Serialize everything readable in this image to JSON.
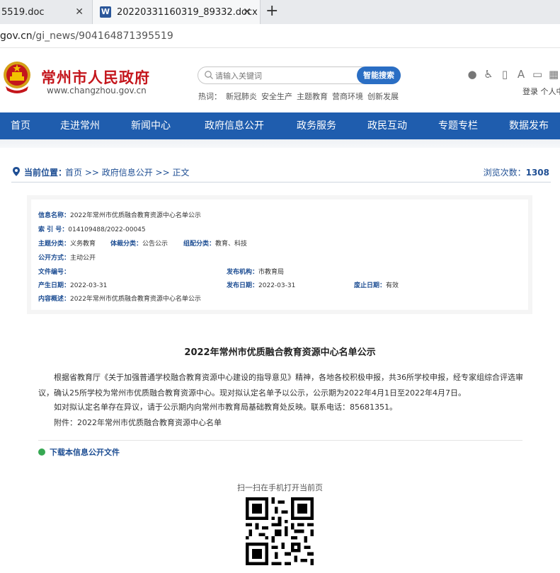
{
  "browser": {
    "tabs": [
      {
        "title": "5519.doc"
      },
      {
        "title": "20220331160319_89332.docx",
        "icon": "word-icon"
      }
    ],
    "new_tab": "+",
    "close": "✕",
    "url_host": "gov.cn",
    "url_path": "/gi_news/904164871395519"
  },
  "header": {
    "site_name": "常州市人民政府",
    "domain": "www.changzhou.gov.cn",
    "search_placeholder": "请输入关键词",
    "search_button": "智能搜索",
    "hot_label": "热词：",
    "hot_words": [
      "新冠肺炎",
      "安全生产",
      "主题教育",
      "营商环境",
      "创新发展"
    ],
    "login": "登录 个人中"
  },
  "nav": [
    "首页",
    "走进常州",
    "新闻中心",
    "政府信息公开",
    "政务服务",
    "政民互动",
    "专题专栏",
    "数据发布"
  ],
  "breadcrumb": {
    "label": "当前位置：",
    "path": "首页 >> 政府信息公开 >> 正文",
    "views_label": "浏览次数：",
    "views": "1308"
  },
  "info": {
    "name_label": "信息名称：",
    "name": "2022年常州市优质融合教育资源中心名单公示",
    "index_label": "索 引 号：",
    "index": "014109488/2022-00045",
    "topic_label": "主题分类：",
    "topic": "义务教育",
    "genre_label": "体裁分类：",
    "genre": "公告公示",
    "org_label": "组配分类：",
    "org": "教育、科技",
    "mode_label": "公开方式：",
    "mode": "主动公开",
    "docno_label": "文件编号：",
    "docno": "",
    "issuer_label": "发布机构：",
    "issuer": "市教育局",
    "created_label": "产生日期：",
    "created": "2022-03-31",
    "published_label": "发布日期：",
    "published": "2022-03-31",
    "expire_label": "废止日期：",
    "expire": "有效",
    "summary_label": "内容概述：",
    "summary": "2022年常州市优质融合教育资源中心名单公示"
  },
  "article": {
    "title": "2022年常州市优质融合教育资源中心名单公示",
    "p1": "根据省教育厅《关于加强普通学校融合教育资源中心建设的指导意见》精神，各地各校积极申报，共36所学校申报，经专家组综合评选审议，确认25所学校为常州市优质融合教育资源中心。现对拟认定名单予以公示，公示期为2022年4月1日至2022年4月7日。",
    "p2": "如对拟认定名单存在异议，请于公示期内向常州市教育局基础教育处反映。联系电话：85681351。",
    "p3": "附件：2022年常州市优质融合教育资源中心名单",
    "download": "下载本信息公开文件",
    "scan": "扫一扫在手机打开当前页"
  }
}
